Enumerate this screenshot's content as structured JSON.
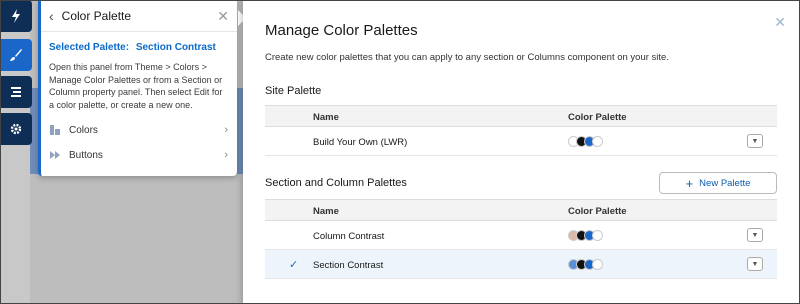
{
  "panel": {
    "title": "Color Palette",
    "selected_prefix": "Selected Palette:",
    "selected_name": "Section Contrast",
    "description": "Open this panel from Theme > Colors > Manage Color Palettes or from a Section or Column property panel. Then select Edit for a color palette, or create a new one.",
    "items": [
      {
        "label": "Colors"
      },
      {
        "label": "Buttons"
      }
    ]
  },
  "rail": {
    "items": [
      "lightning-icon",
      "brush-icon",
      "list-icon",
      "gear-icon"
    ],
    "active_index": 1
  },
  "modal": {
    "title": "Manage Color Palettes",
    "description": "Create new color palettes that you can apply to any section or Columns component on your site.",
    "site_section_title": "Site Palette",
    "section_column_title": "Section and Column Palettes",
    "new_palette_label": "New Palette",
    "col_name": "Name",
    "col_palette": "Color Palette",
    "site_rows": [
      {
        "name": "Build Your Own (LWR)",
        "colors": [
          "#ffffff",
          "#111111",
          "#1b66c9",
          "#ffffff"
        ],
        "selected": false
      }
    ],
    "section_rows": [
      {
        "name": "Column Contrast",
        "colors": [
          "#d9b8a8",
          "#111111",
          "#1b66c9",
          "#ffffff"
        ],
        "selected": false
      },
      {
        "name": "Section Contrast",
        "colors": [
          "#5b8fd8",
          "#111111",
          "#1b66c9",
          "#ffffff"
        ],
        "selected": true
      }
    ]
  }
}
